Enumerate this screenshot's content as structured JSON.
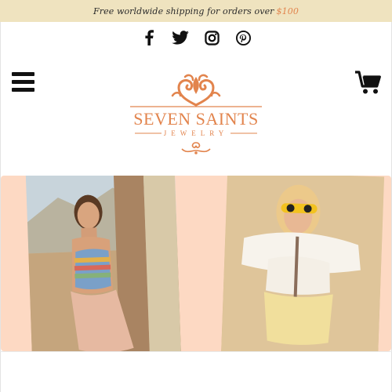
{
  "announcement": {
    "text": "Free worldwide shipping for orders over",
    "amount": "$100"
  },
  "social": {
    "icons": [
      "facebook-icon",
      "twitter-icon",
      "instagram-icon",
      "pinterest-icon"
    ]
  },
  "header": {
    "menu_icon": "hamburger-menu-icon",
    "cart_icon": "shopping-cart-icon"
  },
  "logo": {
    "name": "SEVEN SAINTS",
    "sub": "JEWELRY"
  },
  "colors": {
    "announcement_bg": "#efe3bf",
    "accent": "#e2844d",
    "hero_bg": "#fdd9c3",
    "icon": "#111111"
  }
}
